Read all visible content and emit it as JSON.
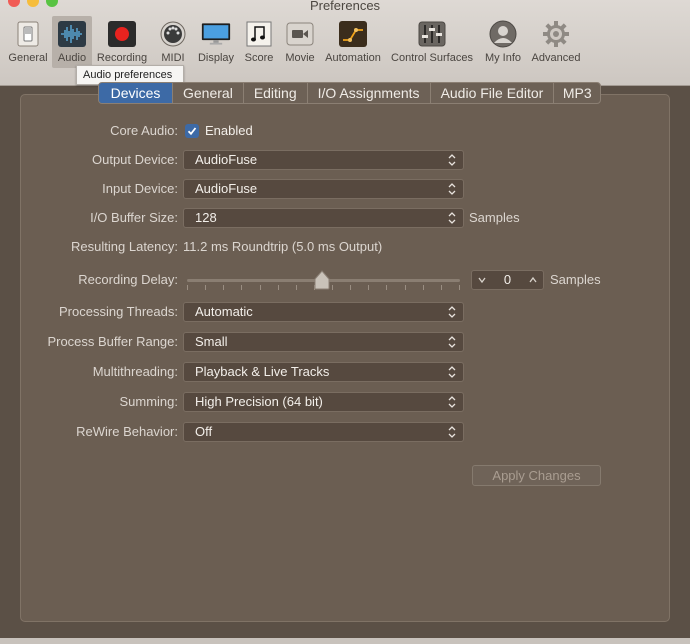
{
  "window": {
    "title": "Preferences"
  },
  "toolbar": [
    {
      "label": "General",
      "icon": "switch-icon"
    },
    {
      "label": "Audio",
      "icon": "waveform-icon",
      "selected": true
    },
    {
      "label": "Recording",
      "icon": "record-icon"
    },
    {
      "label": "MIDI",
      "icon": "midi-icon"
    },
    {
      "label": "Display",
      "icon": "monitor-icon"
    },
    {
      "label": "Score",
      "icon": "score-icon"
    },
    {
      "label": "Movie",
      "icon": "movie-icon"
    },
    {
      "label": "Automation",
      "icon": "automation-icon"
    },
    {
      "label": "Control Surfaces",
      "icon": "faders-icon"
    },
    {
      "label": "My Info",
      "icon": "user-icon"
    },
    {
      "label": "Advanced",
      "icon": "gear-icon"
    }
  ],
  "tooltip": "Audio preferences",
  "tabs": [
    "Devices",
    "General",
    "Editing",
    "I/O Assignments",
    "Audio File Editor",
    "MP3"
  ],
  "form": {
    "core_audio": {
      "label": "Core Audio:",
      "checkbox_label": "Enabled",
      "checked": true
    },
    "output_device": {
      "label": "Output Device:",
      "value": "AudioFuse"
    },
    "input_device": {
      "label": "Input Device:",
      "value": "AudioFuse"
    },
    "io_buffer": {
      "label": "I/O Buffer Size:",
      "value": "128",
      "unit": "Samples"
    },
    "latency": {
      "label": "Resulting Latency:",
      "value": "11.2 ms Roundtrip (5.0 ms Output)"
    },
    "recording_delay": {
      "label": "Recording Delay:",
      "value": "0",
      "unit": "Samples"
    },
    "processing_threads": {
      "label": "Processing Threads:",
      "value": "Automatic"
    },
    "process_buffer": {
      "label": "Process Buffer Range:",
      "value": "Small"
    },
    "multithreading": {
      "label": "Multithreading:",
      "value": "Playback & Live Tracks"
    },
    "summing": {
      "label": "Summing:",
      "value": "High Precision (64 bit)"
    },
    "rewire": {
      "label": "ReWire Behavior:",
      "value": "Off"
    }
  },
  "apply_button": "Apply Changes"
}
